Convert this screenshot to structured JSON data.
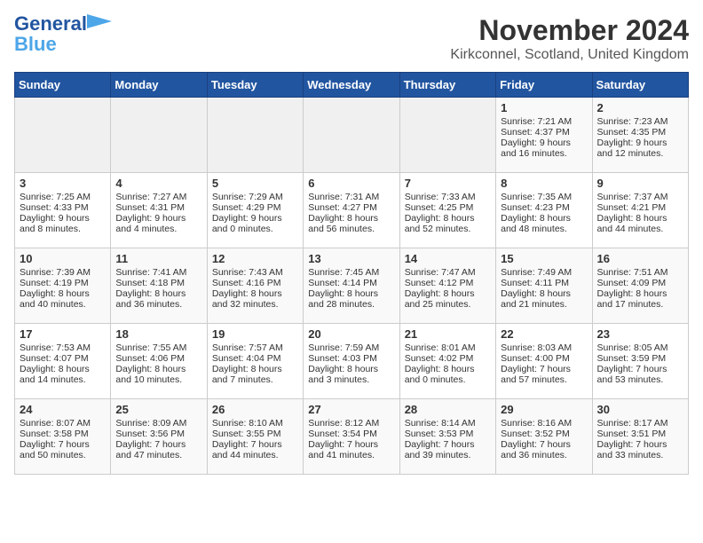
{
  "header": {
    "logo_line1": "General",
    "logo_line2": "Blue",
    "month_title": "November 2024",
    "location": "Kirkconnel, Scotland, United Kingdom"
  },
  "days_of_week": [
    "Sunday",
    "Monday",
    "Tuesday",
    "Wednesday",
    "Thursday",
    "Friday",
    "Saturday"
  ],
  "weeks": [
    [
      {
        "day": "",
        "empty": true
      },
      {
        "day": "",
        "empty": true
      },
      {
        "day": "",
        "empty": true
      },
      {
        "day": "",
        "empty": true
      },
      {
        "day": "",
        "empty": true
      },
      {
        "day": "1",
        "sunrise": "7:21 AM",
        "sunset": "4:37 PM",
        "daylight": "9 hours and 16 minutes."
      },
      {
        "day": "2",
        "sunrise": "7:23 AM",
        "sunset": "4:35 PM",
        "daylight": "9 hours and 12 minutes."
      }
    ],
    [
      {
        "day": "3",
        "sunrise": "7:25 AM",
        "sunset": "4:33 PM",
        "daylight": "9 hours and 8 minutes."
      },
      {
        "day": "4",
        "sunrise": "7:27 AM",
        "sunset": "4:31 PM",
        "daylight": "9 hours and 4 minutes."
      },
      {
        "day": "5",
        "sunrise": "7:29 AM",
        "sunset": "4:29 PM",
        "daylight": "9 hours and 0 minutes."
      },
      {
        "day": "6",
        "sunrise": "7:31 AM",
        "sunset": "4:27 PM",
        "daylight": "8 hours and 56 minutes."
      },
      {
        "day": "7",
        "sunrise": "7:33 AM",
        "sunset": "4:25 PM",
        "daylight": "8 hours and 52 minutes."
      },
      {
        "day": "8",
        "sunrise": "7:35 AM",
        "sunset": "4:23 PM",
        "daylight": "8 hours and 48 minutes."
      },
      {
        "day": "9",
        "sunrise": "7:37 AM",
        "sunset": "4:21 PM",
        "daylight": "8 hours and 44 minutes."
      }
    ],
    [
      {
        "day": "10",
        "sunrise": "7:39 AM",
        "sunset": "4:19 PM",
        "daylight": "8 hours and 40 minutes."
      },
      {
        "day": "11",
        "sunrise": "7:41 AM",
        "sunset": "4:18 PM",
        "daylight": "8 hours and 36 minutes."
      },
      {
        "day": "12",
        "sunrise": "7:43 AM",
        "sunset": "4:16 PM",
        "daylight": "8 hours and 32 minutes."
      },
      {
        "day": "13",
        "sunrise": "7:45 AM",
        "sunset": "4:14 PM",
        "daylight": "8 hours and 28 minutes."
      },
      {
        "day": "14",
        "sunrise": "7:47 AM",
        "sunset": "4:12 PM",
        "daylight": "8 hours and 25 minutes."
      },
      {
        "day": "15",
        "sunrise": "7:49 AM",
        "sunset": "4:11 PM",
        "daylight": "8 hours and 21 minutes."
      },
      {
        "day": "16",
        "sunrise": "7:51 AM",
        "sunset": "4:09 PM",
        "daylight": "8 hours and 17 minutes."
      }
    ],
    [
      {
        "day": "17",
        "sunrise": "7:53 AM",
        "sunset": "4:07 PM",
        "daylight": "8 hours and 14 minutes."
      },
      {
        "day": "18",
        "sunrise": "7:55 AM",
        "sunset": "4:06 PM",
        "daylight": "8 hours and 10 minutes."
      },
      {
        "day": "19",
        "sunrise": "7:57 AM",
        "sunset": "4:04 PM",
        "daylight": "8 hours and 7 minutes."
      },
      {
        "day": "20",
        "sunrise": "7:59 AM",
        "sunset": "4:03 PM",
        "daylight": "8 hours and 3 minutes."
      },
      {
        "day": "21",
        "sunrise": "8:01 AM",
        "sunset": "4:02 PM",
        "daylight": "8 hours and 0 minutes."
      },
      {
        "day": "22",
        "sunrise": "8:03 AM",
        "sunset": "4:00 PM",
        "daylight": "7 hours and 57 minutes."
      },
      {
        "day": "23",
        "sunrise": "8:05 AM",
        "sunset": "3:59 PM",
        "daylight": "7 hours and 53 minutes."
      }
    ],
    [
      {
        "day": "24",
        "sunrise": "8:07 AM",
        "sunset": "3:58 PM",
        "daylight": "7 hours and 50 minutes."
      },
      {
        "day": "25",
        "sunrise": "8:09 AM",
        "sunset": "3:56 PM",
        "daylight": "7 hours and 47 minutes."
      },
      {
        "day": "26",
        "sunrise": "8:10 AM",
        "sunset": "3:55 PM",
        "daylight": "7 hours and 44 minutes."
      },
      {
        "day": "27",
        "sunrise": "8:12 AM",
        "sunset": "3:54 PM",
        "daylight": "7 hours and 41 minutes."
      },
      {
        "day": "28",
        "sunrise": "8:14 AM",
        "sunset": "3:53 PM",
        "daylight": "7 hours and 39 minutes."
      },
      {
        "day": "29",
        "sunrise": "8:16 AM",
        "sunset": "3:52 PM",
        "daylight": "7 hours and 36 minutes."
      },
      {
        "day": "30",
        "sunrise": "8:17 AM",
        "sunset": "3:51 PM",
        "daylight": "7 hours and 33 minutes."
      }
    ]
  ]
}
